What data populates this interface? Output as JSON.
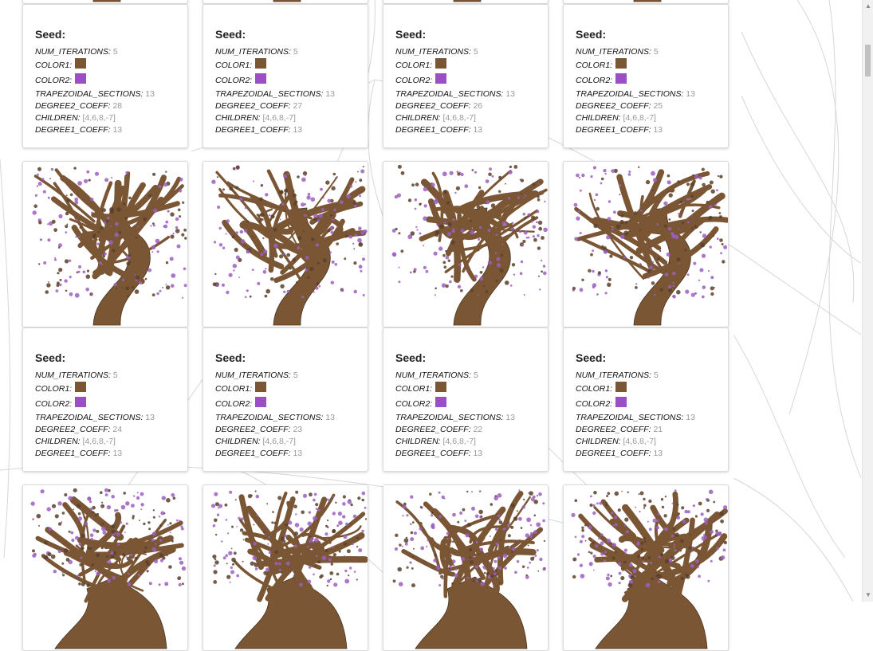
{
  "labels": {
    "seed": "Seed:",
    "num_iterations": "NUM_ITERATIONS:",
    "color1": "COLOR1:",
    "color2": "COLOR2:",
    "trapezoidal_sections": "TRAPEZOIDAL_SECTIONS:",
    "degree2_coeff": "DEGREE2_COEFF:",
    "children": "CHILDREN:",
    "degree1_coeff": "DEGREE1_COEFF:"
  },
  "colors": {
    "bark": "#7a5635",
    "bark_line": "#4a3420",
    "blossom": "#9b5fc0",
    "swatch1": "#7a5635",
    "swatch2": "#9b4fc4"
  },
  "cards": [
    {
      "num_iterations": "5",
      "color1": "#7a5635",
      "color2": "#9b4fc4",
      "trapezoidal_sections": "13",
      "degree2_coeff": "28",
      "children": "[4,6,8,-7]",
      "degree1_coeff": "13"
    },
    {
      "num_iterations": "5",
      "color1": "#7a5635",
      "color2": "#9b4fc4",
      "trapezoidal_sections": "13",
      "degree2_coeff": "27",
      "children": "[4,6,8,-7]",
      "degree1_coeff": "13"
    },
    {
      "num_iterations": "5",
      "color1": "#7a5635",
      "color2": "#9b4fc4",
      "trapezoidal_sections": "13",
      "degree2_coeff": "26",
      "children": "[4,6,8,-7]",
      "degree1_coeff": "13"
    },
    {
      "num_iterations": "5",
      "color1": "#7a5635",
      "color2": "#9b4fc4",
      "trapezoidal_sections": "13",
      "degree2_coeff": "25",
      "children": "[4,6,8,-7]",
      "degree1_coeff": "13"
    },
    {
      "num_iterations": "5",
      "color1": "#7a5635",
      "color2": "#9b4fc4",
      "trapezoidal_sections": "13",
      "degree2_coeff": "24",
      "children": "[4,6,8,-7]",
      "degree1_coeff": "13"
    },
    {
      "num_iterations": "5",
      "color1": "#7a5635",
      "color2": "#9b4fc4",
      "trapezoidal_sections": "13",
      "degree2_coeff": "23",
      "children": "[4,6,8,-7]",
      "degree1_coeff": "13"
    },
    {
      "num_iterations": "5",
      "color1": "#7a5635",
      "color2": "#9b4fc4",
      "trapezoidal_sections": "13",
      "degree2_coeff": "22",
      "children": "[4,6,8,-7]",
      "degree1_coeff": "13"
    },
    {
      "num_iterations": "5",
      "color1": "#7a5635",
      "color2": "#9b4fc4",
      "trapezoidal_sections": "13",
      "degree2_coeff": "21",
      "children": "[4,6,8,-7]",
      "degree1_coeff": "13"
    }
  ]
}
